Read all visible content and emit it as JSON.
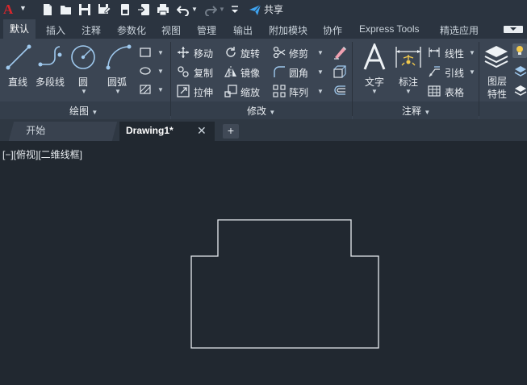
{
  "qat": {
    "logo": "A",
    "share_label": "共享"
  },
  "ribbon_tabs": [
    "默认",
    "插入",
    "注释",
    "参数化",
    "视图",
    "管理",
    "输出",
    "附加模块",
    "协作",
    "Express Tools",
    "精选应用"
  ],
  "draw_panel": {
    "title": "绘图",
    "line": "直线",
    "polyline": "多段线",
    "circle": "圆",
    "arc": "圆弧"
  },
  "modify_panel": {
    "title": "修改",
    "move": "移动",
    "rotate": "旋转",
    "trim": "修剪",
    "copy": "复制",
    "mirror": "镜像",
    "fillet": "圆角",
    "stretch": "拉伸",
    "scale": "缩放",
    "array": "阵列"
  },
  "annotation_panel": {
    "title": "注释",
    "text": "文字",
    "dimension": "标注",
    "linear": "线性",
    "leader": "引线",
    "table": "表格"
  },
  "layers_panel": {
    "properties": "图层\n特性",
    "properties_line1": "图层",
    "properties_line2": "特性"
  },
  "file_tabs": {
    "start": "开始",
    "drawing": "Drawing1*",
    "close": "✕",
    "add": "+"
  },
  "viewport": {
    "label": "[−][俯视][二维线框]"
  },
  "colors": {
    "background": "#212830",
    "ribbon": "#3b4553",
    "logo_red": "#d9262c",
    "share_blue": "#3ea3f0",
    "drawing_stroke": "#e8ecf0"
  }
}
